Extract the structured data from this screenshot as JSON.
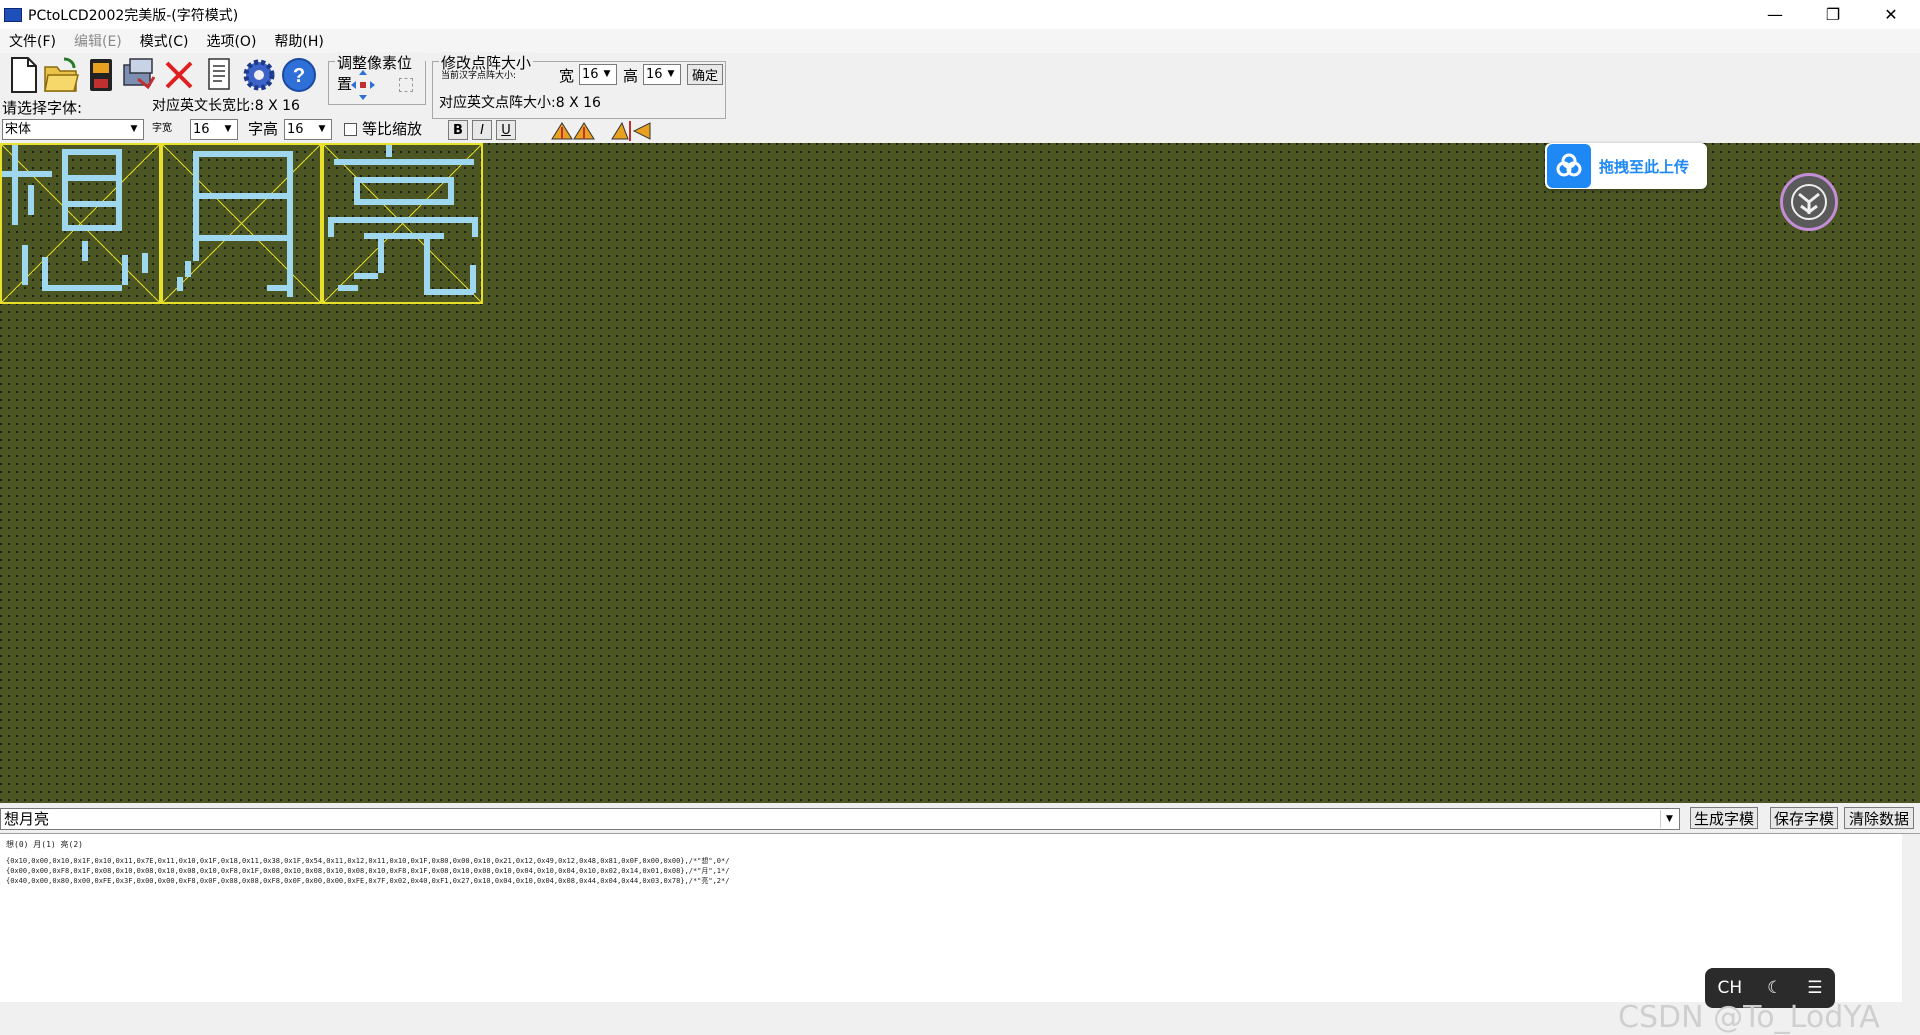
{
  "window": {
    "title": "PCtoLCD2002完美版-(字符模式)"
  },
  "menu": [
    {
      "label": "文件(F)",
      "disabled": false
    },
    {
      "label": "编辑(E)",
      "disabled": true
    },
    {
      "label": "模式(C)",
      "disabled": false
    },
    {
      "label": "选项(O)",
      "disabled": false
    },
    {
      "label": "帮助(H)",
      "disabled": false
    }
  ],
  "toolbar": {
    "font_label": "请选择字体:",
    "font_value": "宋体",
    "char_width_label": "字宽",
    "char_width_value": "16",
    "char_height_label": "字高",
    "char_height_value": "16",
    "ratio_label": "等比缩放",
    "en_ratio_text": "对应英文长宽比:8 X 16",
    "adjust_group": "调整像素位置",
    "resize_group": "修改点阵大小",
    "current_size_label": "当前汉字点阵大小:",
    "width_label": "宽",
    "width_value": "16",
    "height_label": "高",
    "height_value": "16",
    "confirm_btn": "确定",
    "en_size_text": "对应英文点阵大小:8 X 16",
    "bold": "B",
    "italic": "I",
    "underline": "U"
  },
  "canvas": {
    "chars": [
      "想",
      "月",
      "亮"
    ],
    "colors": {
      "grid": "#4b5623",
      "pixel": "#9fd7ef",
      "box": "#e8e02a"
    }
  },
  "upload": {
    "label": "拖拽至此上传"
  },
  "bottom": {
    "input_value": "想月亮",
    "gen_btn": "生成字模",
    "save_btn": "保存字模",
    "clear_btn": "清除数据",
    "index_line": "想(0) 月(1) 亮(2)",
    "lines": [
      "{0x10,0x00,0x10,0x1F,0x10,0x11,0x7E,0x11,0x10,0x1F,0x18,0x11,0x38,0x1F,0x54,0x11,0x12,0x11,0x10,0x1F,0x80,0x00,0x10,0x21,0x12,0x49,0x12,0x48,0x81,0x0F,0x00,0x00},/*\"想\",0*/",
      "{0x00,0x00,0xF8,0x1F,0x08,0x10,0x08,0x10,0x08,0x10,0xF8,0x1F,0x08,0x10,0x08,0x10,0x08,0x10,0xF8,0x1F,0x08,0x10,0x08,0x10,0x04,0x10,0x04,0x10,0x02,0x14,0x01,0x08},/*\"月\",1*/",
      "{0x40,0x00,0x80,0x00,0xFE,0x3F,0x00,0x00,0xF8,0x0F,0x08,0x08,0xF8,0x0F,0x00,0x00,0xFE,0x7F,0x02,0x40,0xF1,0x27,0x10,0x04,0x10,0x04,0x08,0x44,0x04,0x44,0x03,0x78},/*\"亮\",2*/"
    ]
  },
  "ime": {
    "lang": "CH"
  },
  "watermark": "CSDN @To_LodYA"
}
